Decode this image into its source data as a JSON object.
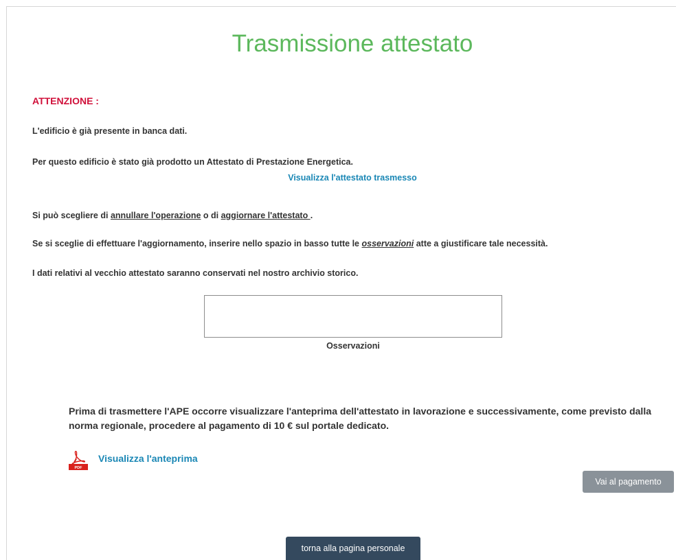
{
  "header": {
    "title": "Trasmissione attestato"
  },
  "warning": {
    "label": "ATTENZIONE :",
    "line1": "L'edificio è già presente in banca dati.",
    "line2": "Per questo edificio è stato già prodotto un Attestato di Prestazione Energetica.",
    "view_link": "Visualizza l'attestato trasmesso"
  },
  "choice": {
    "prefix": "Si può scegliere di ",
    "cancel_link": "annullare l'operazione",
    "middle": " o di ",
    "update_link": "aggiornare l'attestato ",
    "suffix": "."
  },
  "update_info": {
    "prefix": "Se si sceglie di effettuare l'aggiornamento, inserire nello spazio in basso tutte le ",
    "emphasis": "osservazioni",
    "suffix": " atte a giustificare tale necessità."
  },
  "archive_note": "I dati relativi al vecchio attestato saranno conservati nel nostro archivio storico.",
  "observations": {
    "value": "",
    "label": "Osservazioni"
  },
  "payment": {
    "notice": "Prima di trasmettere l'APE occorre visualizzare l'anteprima dell'attestato in lavorazione e successivamente, come previsto dalla norma regionale, procedere al pagamento di 10 € sul portale dedicato.",
    "preview_link": "Visualizza l'anteprima",
    "pay_button": "Vai al pagamento"
  },
  "footer": {
    "home_button": "torna alla pagina personale"
  },
  "icons": {
    "pdf": "pdf-icon"
  },
  "colors": {
    "title": "#5cb85c",
    "attention": "#d0103a",
    "link": "#1a87b5",
    "pay_button": "#8a9299",
    "home_button": "#34495e"
  }
}
